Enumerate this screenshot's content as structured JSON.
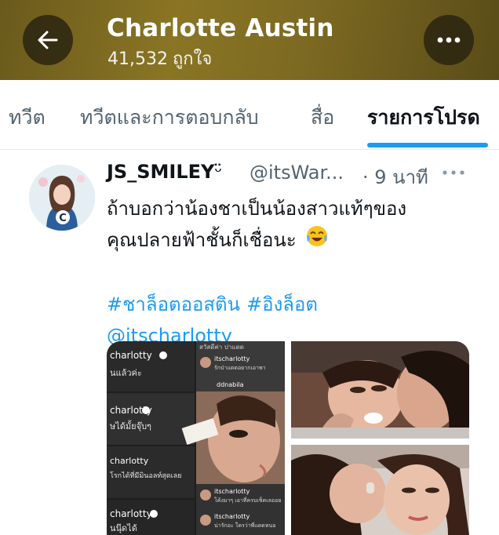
{
  "header": {
    "title": "Charlotte Austin",
    "likes_count": "41,532",
    "likes_label": "ถูกใจ"
  },
  "tabs": [
    {
      "label": "ทวีต"
    },
    {
      "label": "ทวีตและการตอบกลับ"
    },
    {
      "label": "สื่อ"
    },
    {
      "label": "รายการโปรด",
      "active": true
    }
  ],
  "tweet": {
    "display_name": "JS_SMILEY",
    "name_emoji": "ᵕ̈",
    "handle": "@itsWar...",
    "time": "· 9 นาที",
    "text_line1": "ถ้าบอกว่าน้องชาเป็นน้องสาวแท้ๆของ",
    "text_line2": "คุณปลายฟ้าชั้นก็เชื่อนะ",
    "hashtag1": "#ชาล็อตออสติน",
    "hashtag2": "#อิงล็อต",
    "mention": "@itscharlotty",
    "media": {
      "screenshot_labels": [
        "charlotty",
        "นแล้วค่ะ",
        "charlotty",
        "ษได้มั้ยจุ๊บๆ",
        "charlotty",
        "โรกได้ที่มีมินอลท์สุดเลย",
        "charlotty",
        "นนุ๊ดได้"
      ],
      "chat_labels": [
        "itscharlotty",
        "รักป่าแดดอยากเอาพา",
        "ddnabila",
        "itscharlotty",
        "โค้งมาๆ เอาที่ครบเช็คเลออย",
        "itscharlotty",
        "น่ารักอะ ใครว่าพี่แดดหนอ"
      ],
      "top_caption": "สวัสดีค่า ปาแดด"
    }
  },
  "colors": {
    "accent": "#1d9bf0",
    "header_bg": "#7d6a22",
    "text_primary": "#0f1419",
    "text_secondary": "#536471"
  }
}
